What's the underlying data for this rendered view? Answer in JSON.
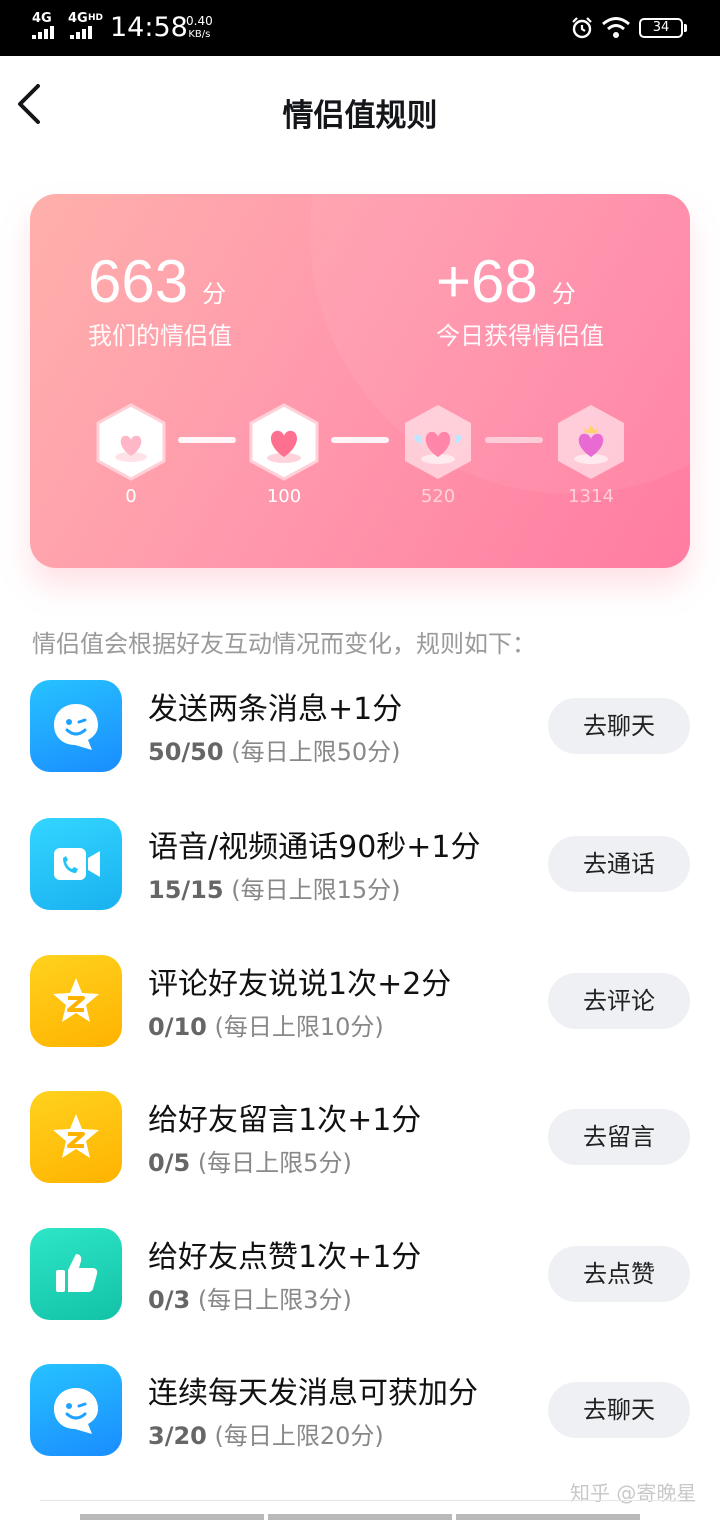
{
  "status_bar": {
    "net1": "4G",
    "net2": "4G",
    "net2_sup": "HD",
    "time": "14:58",
    "speed_value": "0.40",
    "speed_unit": "KB/s",
    "battery": "34"
  },
  "header": {
    "title": "情侣值规则"
  },
  "card": {
    "current_score": "663",
    "current_unit": "分",
    "current_label": "我们的情侣值",
    "today_score": "+68",
    "today_unit": "分",
    "today_label": "今日获得情侣值",
    "levels": [
      {
        "value": "0",
        "reached": true
      },
      {
        "value": "100",
        "reached": true
      },
      {
        "value": "520",
        "reached": false
      },
      {
        "value": "1314",
        "reached": false
      }
    ]
  },
  "rules": {
    "description": "情侣值会根据好友互动情况而变化，规则如下：",
    "items": [
      {
        "icon": "chat-bubble-icon",
        "title": "发送两条消息+1分",
        "progress": "50/50",
        "limit": "(每日上限50分)",
        "button": "去聊天",
        "color": "#1fa2ff"
      },
      {
        "icon": "video-call-icon",
        "title": "语音/视频通话90秒+1分",
        "progress": "15/15",
        "limit": "(每日上限15分)",
        "button": "去通话",
        "color": "#22c4f5"
      },
      {
        "icon": "qzone-star-icon",
        "title": "评论好友说说1次+2分",
        "progress": "0/10",
        "limit": "(每日上限10分)",
        "button": "去评论",
        "color": "#ffc400"
      },
      {
        "icon": "qzone-star-icon",
        "title": "给好友留言1次+1分",
        "progress": "0/5",
        "limit": "(每日上限5分)",
        "button": "去留言",
        "color": "#ffc400"
      },
      {
        "icon": "thumbs-up-icon",
        "title": "给好友点赞1次+1分",
        "progress": "0/3",
        "limit": "(每日上限3分)",
        "button": "去点赞",
        "color": "#1fd6b8"
      },
      {
        "icon": "chat-bubble-icon",
        "title": "连续每天发消息可获加分",
        "progress": "3/20",
        "limit": "(每日上限20分)",
        "button": "去聊天",
        "color": "#1fa2ff"
      }
    ]
  },
  "watermark": "知乎 @寄晚星"
}
